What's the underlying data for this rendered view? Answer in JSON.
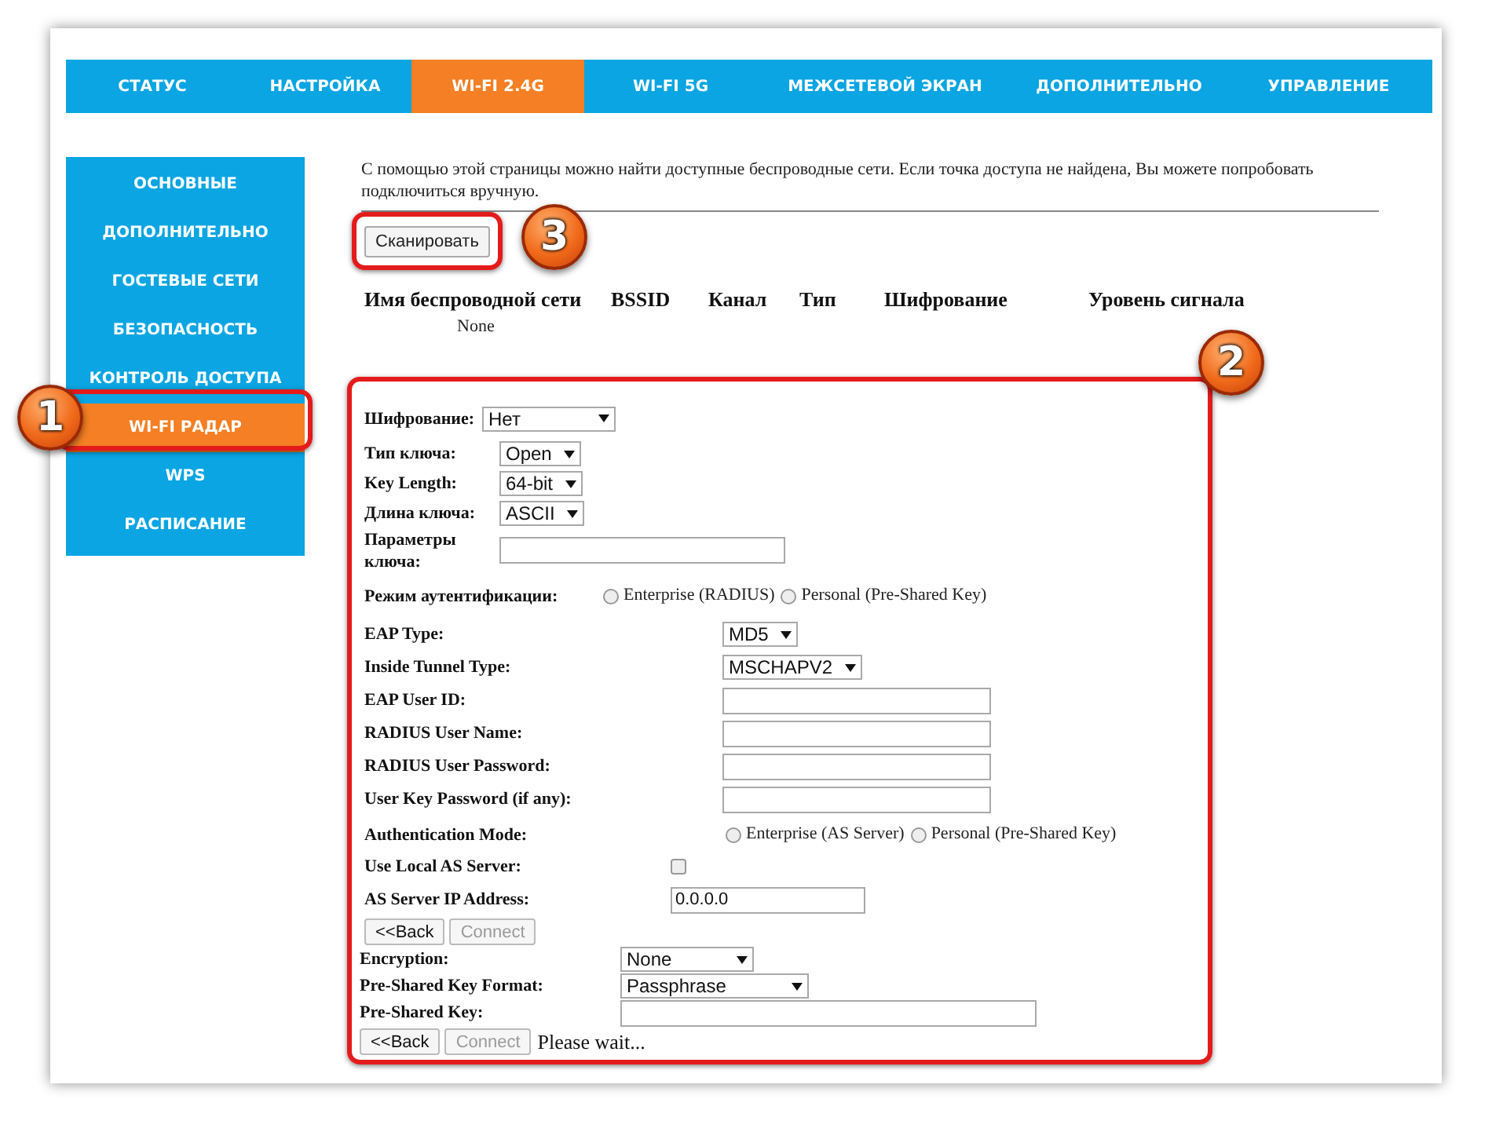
{
  "nav_tabs": [
    {
      "label": "СТАТУС",
      "selected": false
    },
    {
      "label": "НАСТРОЙКА",
      "selected": false
    },
    {
      "label": "WI-FI 2.4G",
      "selected": true
    },
    {
      "label": "WI-FI 5G",
      "selected": false
    },
    {
      "label": "МЕЖСЕТЕВОЙ ЭКРАН",
      "selected": false
    },
    {
      "label": "ДОПОЛНИТЕЛЬНО",
      "selected": false
    },
    {
      "label": "УПРАВЛЕНИЕ",
      "selected": false
    }
  ],
  "sidebar": {
    "items": [
      {
        "label": "ОСНОВНЫЕ",
        "selected": false
      },
      {
        "label": "ДОПОЛНИТЕЛЬНО",
        "selected": false
      },
      {
        "label": "ГОСТЕВЫЕ СЕТИ",
        "selected": false
      },
      {
        "label": "БЕЗОПАСНОСТЬ",
        "selected": false
      },
      {
        "label": "КОНТРОЛЬ ДОСТУПА",
        "selected": false
      },
      {
        "label": "WI-FI РАДАР",
        "selected": true
      },
      {
        "label": "WPS",
        "selected": false
      },
      {
        "label": "РАСПИСАНИЕ",
        "selected": false
      }
    ]
  },
  "intro": "С помощью этой страницы можно найти доступные беспроводные сети. Если точка доступа не найдена, Вы можете попробовать подключиться вручную.",
  "scan_button": "Сканировать",
  "results": {
    "columns": [
      "Имя беспроводной сети",
      "BSSID",
      "Канал",
      "Тип",
      "Шифрование",
      "Уровень сигнала"
    ],
    "empty_text": "None"
  },
  "form": {
    "groups": [
      {
        "rows": [
          {
            "kind": "select",
            "label": "Шифрование:",
            "value": "Нет"
          }
        ]
      },
      {
        "rows": [
          {
            "kind": "select",
            "label": "Тип ключа:",
            "value": "Open"
          },
          {
            "kind": "select",
            "label": "Key Length:",
            "value": "64-bit"
          },
          {
            "kind": "select",
            "label": "Длина ключа:",
            "value": "ASCII"
          },
          {
            "kind": "text",
            "label": "Параметры ключа:"
          }
        ]
      },
      {
        "rows": [
          {
            "kind": "radio",
            "label": "Режим аутентификации:",
            "options": [
              {
                "label": "Enterprise (RADIUS)",
                "selected": false
              },
              {
                "label": "Personal (Pre-Shared Key)",
                "selected": false
              }
            ]
          }
        ]
      },
      {
        "rows": [
          {
            "kind": "select",
            "label": "EAP Type:",
            "value": "MD5"
          },
          {
            "kind": "select",
            "label": "Inside Tunnel Type:",
            "value": "MSCHAPV2"
          },
          {
            "kind": "text",
            "label": "EAP User ID:"
          },
          {
            "kind": "text",
            "label": "RADIUS User Name:"
          },
          {
            "kind": "text",
            "label": "RADIUS User Password:"
          },
          {
            "kind": "text",
            "label": "User Key Password (if any):"
          }
        ]
      },
      {
        "rows": [
          {
            "kind": "radio",
            "label": "Authentication Mode:",
            "options": [
              {
                "label": "Enterprise (AS Server)",
                "selected": false
              },
              {
                "label": "Personal (Pre-Shared Key)",
                "selected": false
              }
            ]
          }
        ]
      },
      {
        "rows": [
          {
            "kind": "checkbox",
            "label": "Use Local AS Server:",
            "checked": false
          },
          {
            "kind": "text",
            "label": "AS Server IP Address:",
            "value": "0.0.0.0"
          }
        ]
      },
      {
        "rows": [
          {
            "kind": "buttons",
            "buttons": [
              {
                "label": "<<Back",
                "disabled": false
              },
              {
                "label": "Connect",
                "disabled": true
              }
            ]
          }
        ]
      },
      {
        "rows": [
          {
            "kind": "select",
            "label": "Encryption:",
            "value": "None"
          },
          {
            "kind": "select",
            "label": "Pre-Shared Key Format:",
            "value": "Passphrase"
          },
          {
            "kind": "text",
            "label": "Pre-Shared Key:"
          }
        ]
      },
      {
        "rows": [
          {
            "kind": "buttons",
            "buttons": [
              {
                "label": "<<Back",
                "disabled": false
              },
              {
                "label": "Connect",
                "disabled": true
              }
            ],
            "note": "Please wait..."
          }
        ]
      }
    ]
  },
  "annotations": [
    {
      "label": "1"
    },
    {
      "label": "2"
    },
    {
      "label": "3"
    }
  ]
}
